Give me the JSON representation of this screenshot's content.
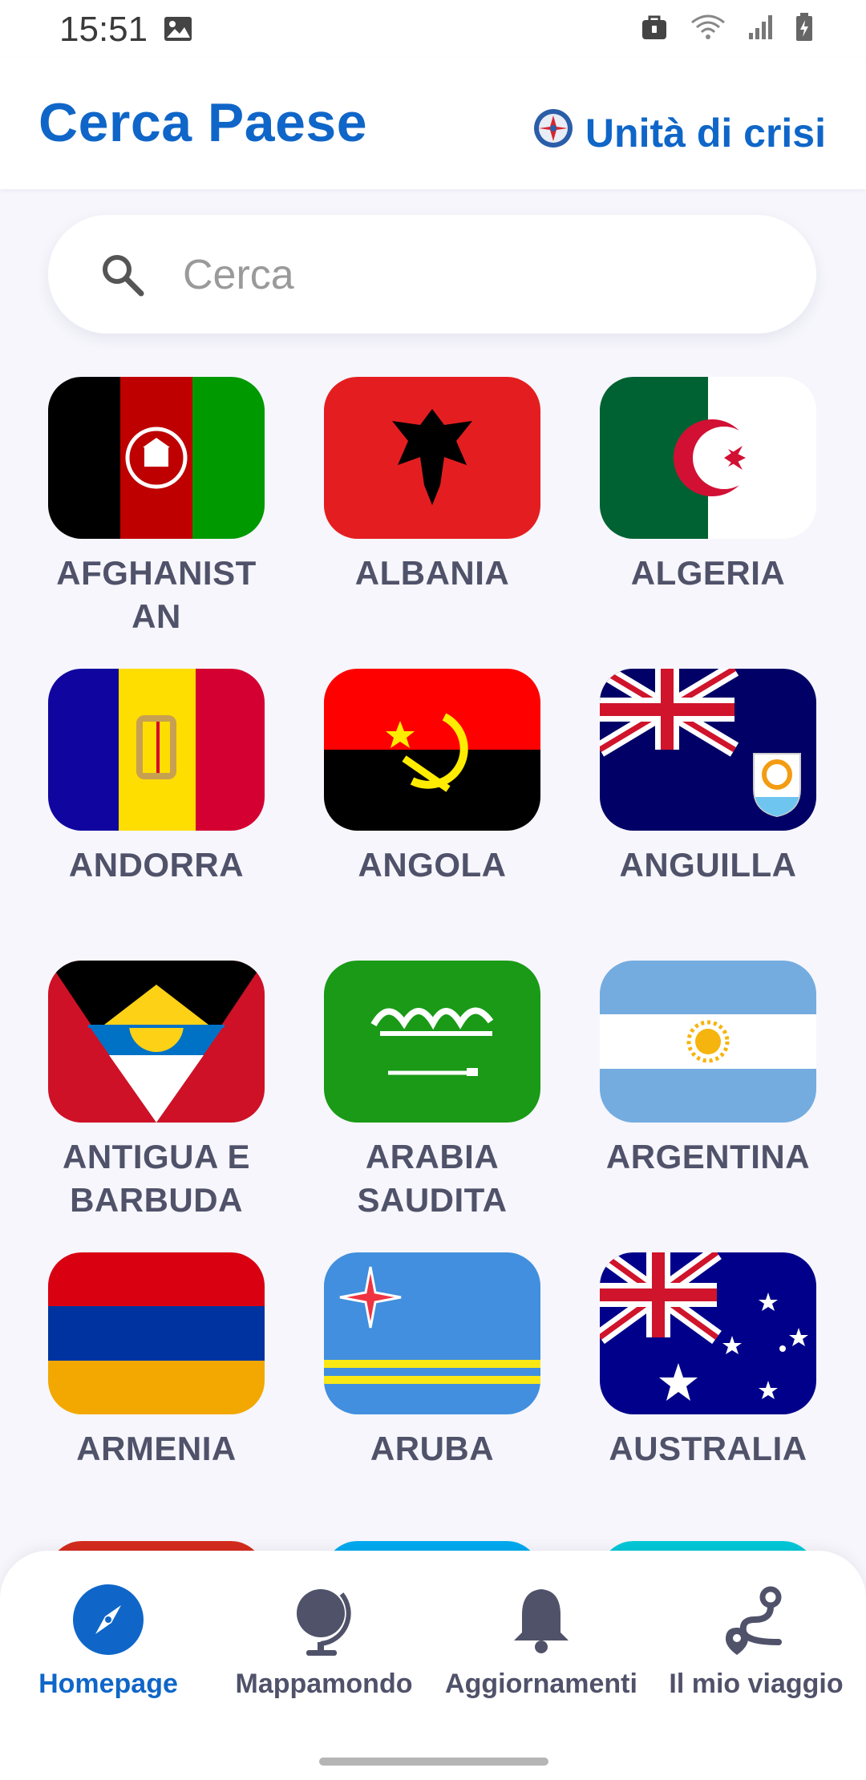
{
  "status_bar": {
    "time": "15:51",
    "icons": [
      "image-icon",
      "lock-bag-icon",
      "wifi-icon",
      "signal-icon",
      "battery-icon"
    ]
  },
  "header": {
    "title": "Cerca Paese",
    "crisis_label": "Unità di crisi",
    "crisis_icon": "crisis-unit-logo-icon"
  },
  "search": {
    "placeholder": "Cerca",
    "value": ""
  },
  "countries": [
    {
      "name": "AFGHANISTAN",
      "line1": "AFGHANIST",
      "line2": "AN"
    },
    {
      "name": "ALBANIA",
      "line1": "ALBANIA",
      "line2": ""
    },
    {
      "name": "ALGERIA",
      "line1": "ALGERIA",
      "line2": ""
    },
    {
      "name": "ANDORRA",
      "line1": "ANDORRA",
      "line2": ""
    },
    {
      "name": "ANGOLA",
      "line1": "ANGOLA",
      "line2": ""
    },
    {
      "name": "ANGUILLA",
      "line1": "ANGUILLA",
      "line2": ""
    },
    {
      "name": "ANTIGUA E BARBUDA",
      "line1": "ANTIGUA E",
      "line2": "BARBUDA"
    },
    {
      "name": "ARABIA SAUDITA",
      "line1": "ARABIA",
      "line2": "SAUDITA"
    },
    {
      "name": "ARGENTINA",
      "line1": "ARGENTINA",
      "line2": ""
    },
    {
      "name": "ARMENIA",
      "line1": "ARMENIA",
      "line2": ""
    },
    {
      "name": "ARUBA",
      "line1": "ARUBA",
      "line2": ""
    },
    {
      "name": "AUSTRALIA",
      "line1": "AUSTRALIA",
      "line2": ""
    }
  ],
  "bottom_nav": [
    {
      "label": "Homepage",
      "icon": "compass-icon",
      "active": true
    },
    {
      "label": "Mappamondo",
      "icon": "globe-icon",
      "active": false
    },
    {
      "label": "Aggiornamenti",
      "icon": "bell-icon",
      "active": false
    },
    {
      "label": "Il mio viaggio",
      "icon": "route-icon",
      "active": false
    }
  ],
  "colors": {
    "accent": "#0f66c8",
    "label": "#50526a",
    "background": "#f6f6fc"
  }
}
